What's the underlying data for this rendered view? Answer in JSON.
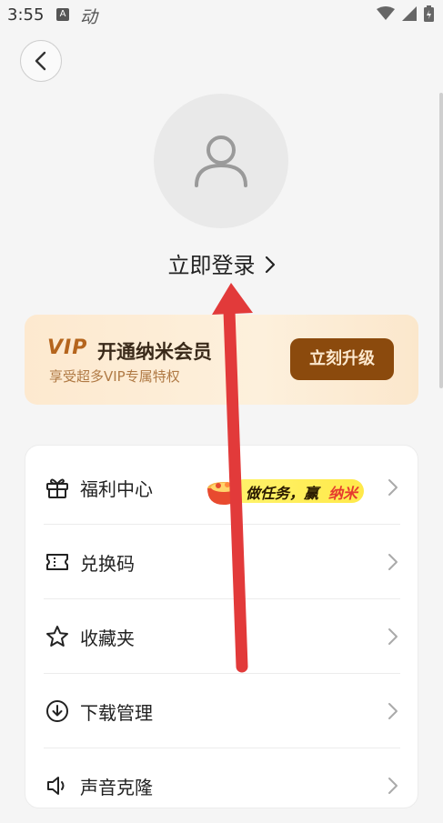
{
  "status_bar": {
    "time": "3:55",
    "app_glyph": "A",
    "app_text": "动"
  },
  "profile": {
    "login_text": "立即登录"
  },
  "vip": {
    "badge": "VIP",
    "title": "开通纳米会员",
    "subtitle": "享受超多VIP专属特权",
    "upgrade_label": "立刻升级",
    "colors": {
      "accent": "#8b4a0d",
      "card_bg": "#fdecd5"
    }
  },
  "promo": {
    "text_main": "做任务，赢",
    "text_highlight": "纳米"
  },
  "menu": {
    "items": [
      {
        "label": "福利中心",
        "icon": "gift-icon"
      },
      {
        "label": "兑换码",
        "icon": "ticket-icon"
      },
      {
        "label": "收藏夹",
        "icon": "star-icon"
      },
      {
        "label": "下载管理",
        "icon": "download-icon"
      },
      {
        "label": "声音克隆",
        "icon": "sound-icon"
      }
    ]
  },
  "overlay": {
    "arrow_color": "#e23a3a"
  }
}
